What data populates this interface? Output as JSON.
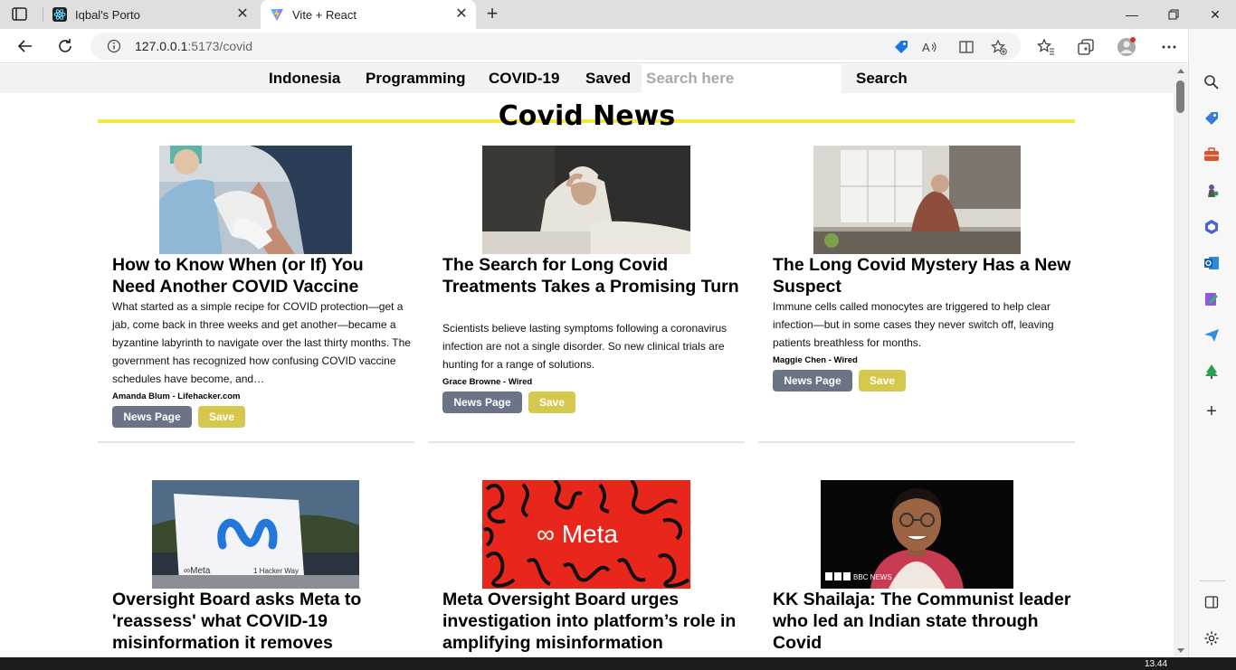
{
  "browser": {
    "tabs": [
      {
        "title": "Iqbal's Porto",
        "icon": "react-icon",
        "active": false
      },
      {
        "title": "Vite + React",
        "icon": "vite-icon",
        "active": true
      }
    ],
    "address": {
      "host": "127.0.0.1",
      "port_path": ":5173/covid"
    }
  },
  "nav": {
    "items": [
      "Indonesia",
      "Programming",
      "COVID-19",
      "Saved"
    ],
    "search_placeholder": "Search here",
    "search_button": "Search"
  },
  "page": {
    "title": "Covid News"
  },
  "articles": [
    {
      "title": "How to Know When (or If) You Need Another COVID Vaccine",
      "description": "What started as a simple recipe for COVID protection—get a jab, come back in three weeks and get another—became a byzantine labyrinth to navigate over the last thirty months. The government has recognized how confusing COVID vaccine schedules have become, and…",
      "author": "Amanda Blum - Lifehacker.com",
      "image": "vaccine-photo",
      "news_button": "News Page",
      "save_button": "Save"
    },
    {
      "title": "The Search for Long Covid Treatments Takes a Promising Turn",
      "description": "Scientists believe lasting symptoms following a coronavirus infection are not a single disorder. So new clinical trials are hunting for a range of solutions.",
      "author": "Grace Browne - Wired",
      "image": "tired-woman-photo",
      "news_button": "News Page",
      "save_button": "Save"
    },
    {
      "title": "The Long Covid Mystery Has a New Suspect",
      "description": "Immune cells called monocytes are triggered to help clear infection—but in some cases they never switch off, leaving patients breathless for months.",
      "author": "Maggie Chen - Wired",
      "image": "man-kitchen-photo",
      "news_button": "News Page",
      "save_button": "Save"
    },
    {
      "title": "Oversight Board asks Meta to 'reassess' what COVID-19 misinformation it removes",
      "image": "meta-sign-photo",
      "image_text": [
        "∞Meta",
        "1 Hacker Way"
      ]
    },
    {
      "title": "Meta Oversight Board urges investigation into platform’s role in amplifying misinformation",
      "image": "meta-logo-red",
      "image_text": [
        "∞ Meta"
      ]
    },
    {
      "title": "KK Shailaja: The Communist leader who led an Indian state through Covid",
      "image": "shailaja-portrait",
      "image_text": [
        "BBC NEWS"
      ]
    }
  ],
  "taskbar": {
    "clock": "13.44"
  },
  "colors": {
    "news_button": "#6b7486",
    "save_button": "#d6c84d",
    "title_underline": "#f5e83a"
  }
}
